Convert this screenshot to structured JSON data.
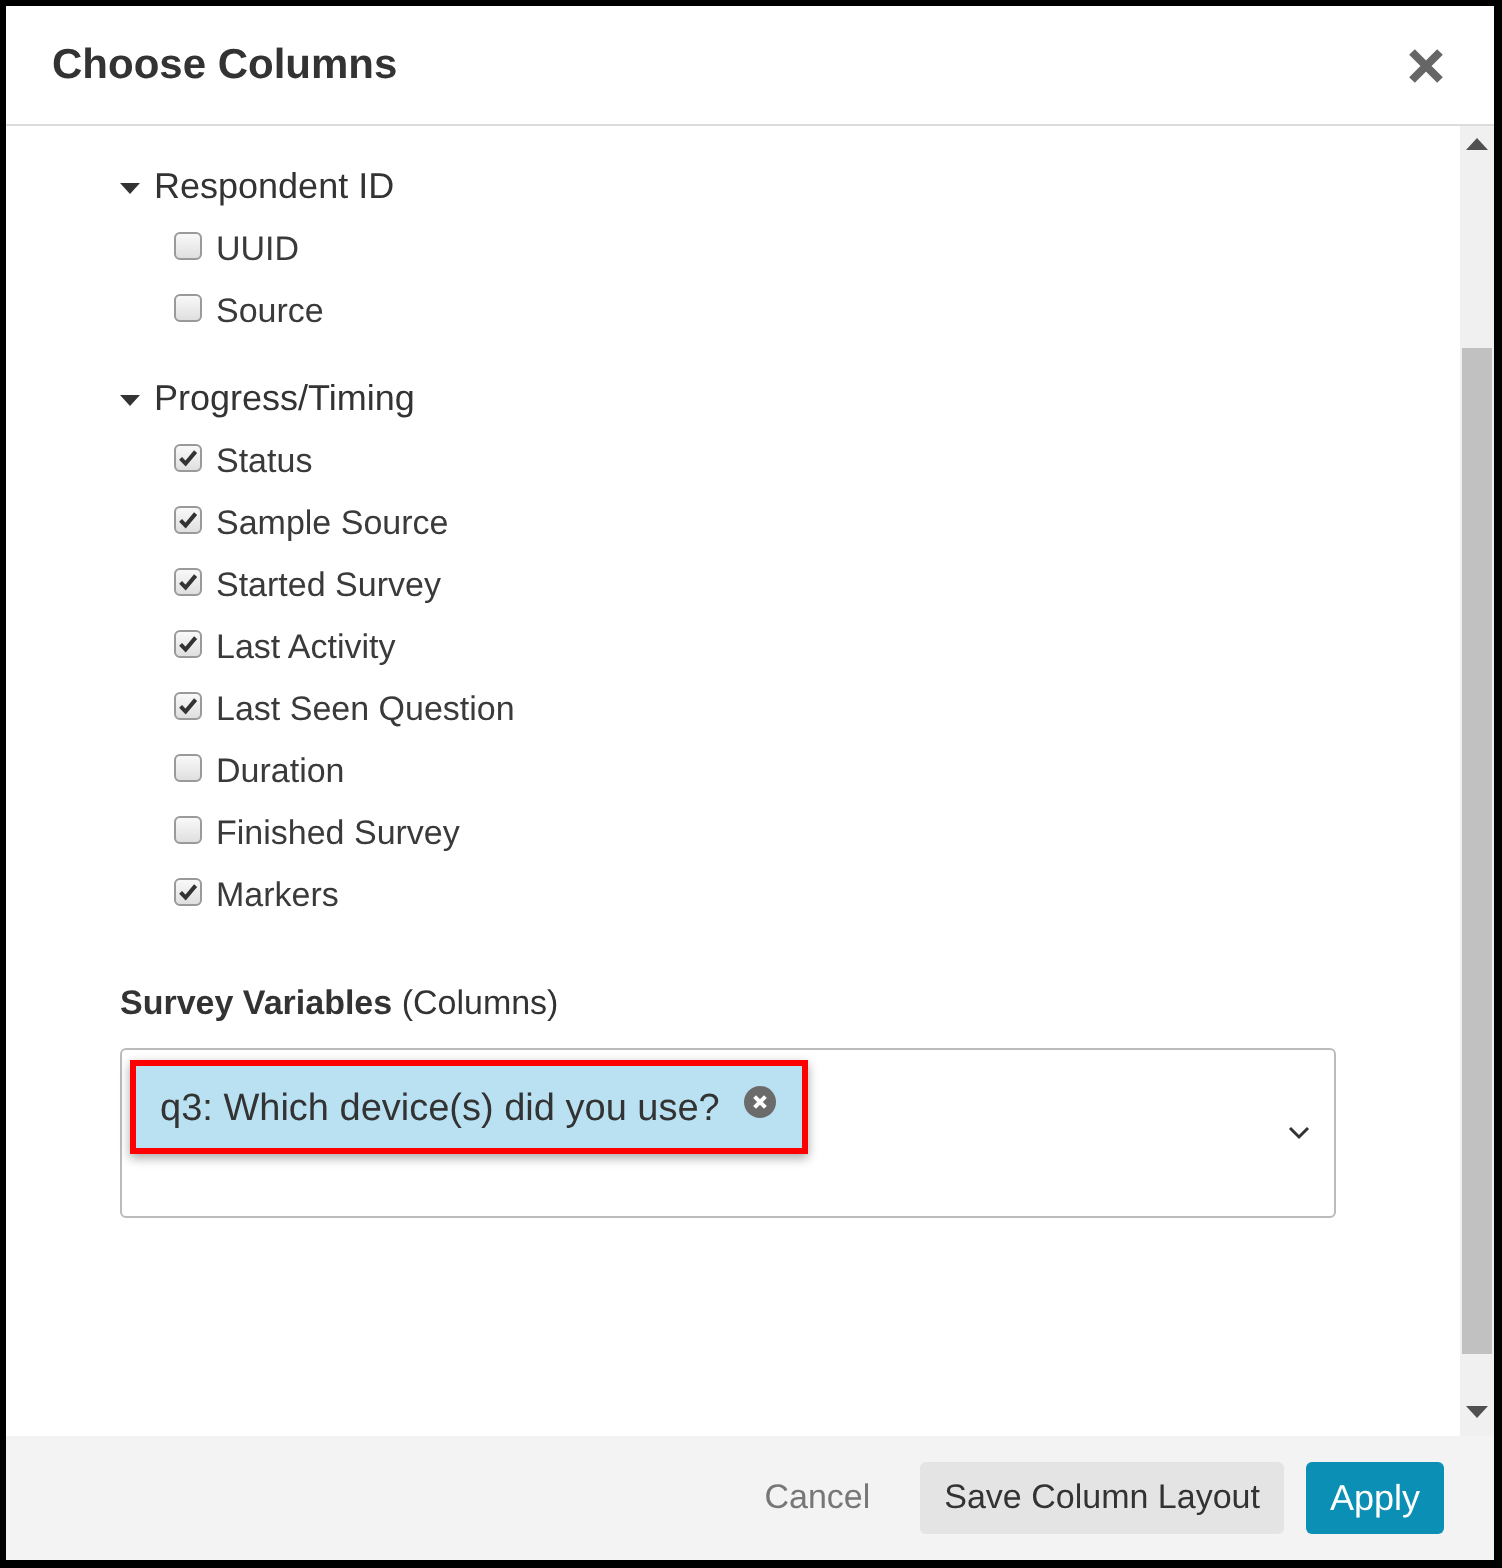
{
  "dialog": {
    "title": "Choose Columns"
  },
  "sections": [
    {
      "title": "Respondent ID",
      "expanded": true,
      "items": [
        {
          "label": "UUID",
          "checked": false
        },
        {
          "label": "Source",
          "checked": false
        }
      ]
    },
    {
      "title": "Progress/Timing",
      "expanded": true,
      "items": [
        {
          "label": "Status",
          "checked": true
        },
        {
          "label": "Sample Source",
          "checked": true
        },
        {
          "label": "Started Survey",
          "checked": true
        },
        {
          "label": "Last Activity",
          "checked": true
        },
        {
          "label": "Last Seen Question",
          "checked": true
        },
        {
          "label": "Duration",
          "checked": false
        },
        {
          "label": "Finished Survey",
          "checked": false
        },
        {
          "label": "Markers",
          "checked": true
        }
      ]
    }
  ],
  "survey_variables": {
    "label": "**Survey Variables** (Columns)",
    "tags": [
      {
        "label": "q3: Which device(s) did you use?",
        "highlighted": true
      }
    ]
  },
  "footer": {
    "buttons": [
      {
        "label": "Cancel",
        "kind": "link"
      },
      {
        "label": "Save Column Layout",
        "kind": "secondary"
      },
      {
        "label": "Apply",
        "kind": "primary"
      }
    ]
  }
}
